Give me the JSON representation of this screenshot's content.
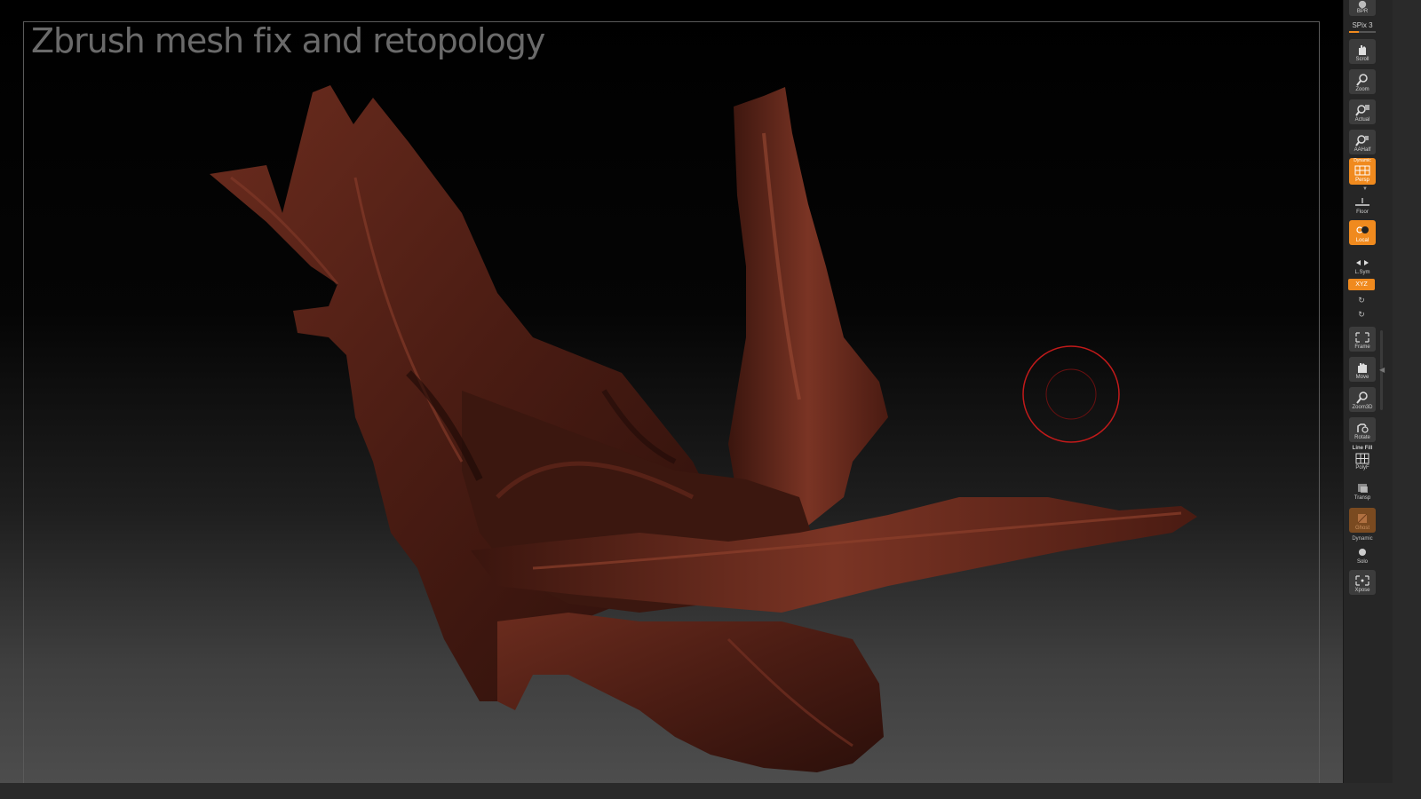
{
  "overlay": {
    "title": "Zbrush mesh fix and retopology"
  },
  "shelf": {
    "top_button": {
      "label": "BPR",
      "icon": "sphere-icon"
    },
    "spix": {
      "label": "SPix 3",
      "level": 0.36
    },
    "buttons": [
      {
        "id": "scroll",
        "label": "Scroll",
        "icon": "hand-scroll-icon",
        "state": "normal"
      },
      {
        "id": "zoom",
        "label": "Zoom",
        "icon": "magnifier-icon",
        "state": "normal"
      },
      {
        "id": "actual",
        "label": "Actual",
        "icon": "magnifier-actual-icon",
        "state": "normal"
      },
      {
        "id": "aahalf",
        "label": "AAHalf",
        "icon": "magnifier-aahalf-icon",
        "state": "normal"
      },
      {
        "id": "persp",
        "label": "Persp",
        "top_label": "Dynamic",
        "icon": "perspective-grid-icon",
        "state": "active"
      },
      {
        "id": "floor",
        "label": "Floor",
        "icon": "floor-icon",
        "state": "normal"
      },
      {
        "id": "local",
        "label": "Local",
        "icon": "local-symmetry-icon",
        "state": "active"
      },
      {
        "id": "lsym",
        "label": "L.Sym",
        "icon": "lsym-arrows-icon",
        "state": "normal"
      },
      {
        "id": "frame",
        "label": "Frame",
        "icon": "frame-icon",
        "state": "normal"
      },
      {
        "id": "move",
        "label": "Move",
        "icon": "hand-move-icon",
        "state": "normal"
      },
      {
        "id": "zoom3d",
        "label": "Zoom3D",
        "icon": "magnifier-3d-icon",
        "state": "normal"
      },
      {
        "id": "rotate",
        "label": "Rotate",
        "icon": "rotate-icon",
        "state": "normal"
      },
      {
        "id": "polyf",
        "label": "PolyF",
        "top_label": "Line Fill",
        "icon": "polyframe-grid-icon",
        "state": "normal"
      },
      {
        "id": "transp",
        "label": "Transp",
        "icon": "transparency-icon",
        "state": "normal"
      },
      {
        "id": "ghost",
        "label": "Ghost",
        "icon": "ghost-icon",
        "state": "dim"
      },
      {
        "id": "solo",
        "label": "Solo",
        "top_label": "Dynamic",
        "icon": "solo-icon",
        "state": "normal"
      },
      {
        "id": "xpose",
        "label": "Xpose",
        "icon": "xpose-icon",
        "state": "normal"
      }
    ],
    "xyz_label": "XYZ"
  },
  "colors": {
    "accent_orange": "#f08a1e",
    "cursor_red": "#c21a1a",
    "wood_dark": "#2e120c",
    "wood_mid": "#5a2418",
    "wood_light": "#7a3626"
  }
}
